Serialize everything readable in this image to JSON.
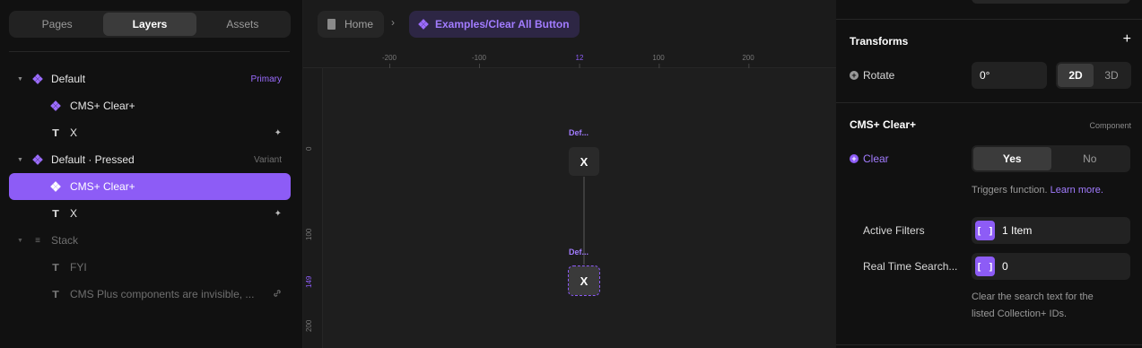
{
  "left_panel": {
    "tabs": [
      "Pages",
      "Layers",
      "Assets"
    ],
    "active_tab": "Layers",
    "layers": [
      {
        "label": "Default",
        "tag": "Primary",
        "icon": "component-icon"
      },
      {
        "label": "CMS+ Clear+",
        "icon": "component-icon"
      },
      {
        "label": "X",
        "icon": "text-icon",
        "action": "✦"
      },
      {
        "label": "Default · Pressed",
        "tag": "Variant",
        "icon": "component-icon"
      },
      {
        "label": "CMS+ Clear+",
        "icon": "component-icon",
        "selected": true
      },
      {
        "label": "X",
        "icon": "text-icon",
        "action": "✦"
      },
      {
        "label": "Stack",
        "icon": "stack-icon"
      },
      {
        "label": "FYI",
        "icon": "text-icon"
      },
      {
        "label": "CMS Plus components are invisible, ...",
        "icon": "text-icon",
        "action": "link"
      }
    ]
  },
  "breadcrumb": {
    "home": "Home",
    "separator": "›",
    "current": "Examples/Clear All Button"
  },
  "canvas": {
    "ruler_top": [
      "-200",
      "-100",
      "12",
      "100",
      "200"
    ],
    "ruler_left": [
      "0",
      "100",
      "149",
      "200"
    ],
    "variant_label_1": "Def...",
    "variant_label_2": "Def...",
    "button_text_1": "X",
    "button_text_2": "X"
  },
  "right_panel": {
    "transforms": {
      "title": "Transforms",
      "add": "+",
      "rotate_label": "Rotate",
      "rotate_value": "0°",
      "mode_2d": "2D",
      "mode_3d": "3D"
    },
    "component": {
      "title": "CMS+ Clear+",
      "subtitle": "Component",
      "clear_label": "Clear",
      "yes": "Yes",
      "no": "No",
      "note_text": "Triggers function.",
      "note_link": "Learn more.",
      "active_filters_label": "Active Filters",
      "active_filters_value": "1 Item",
      "realtime_label": "Real Time Search...",
      "realtime_value": "0",
      "clear_note_1": "Clear the search text for the",
      "clear_note_2": "listed Collection+ IDs."
    }
  },
  "colors": {
    "accent": "#8d5cf6",
    "panel_bg": "#111111",
    "canvas_bg": "#1e1e1e"
  }
}
